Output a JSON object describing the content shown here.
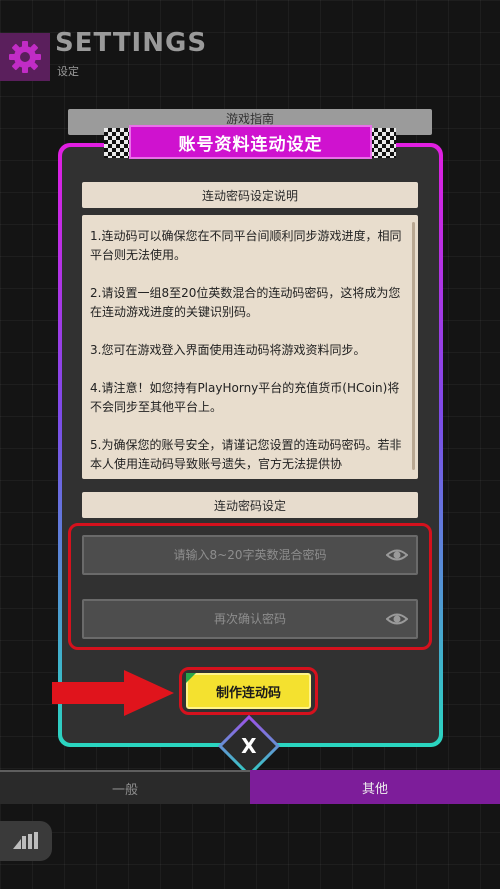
{
  "header": {
    "title": "SETTINGS",
    "subtitle": "设定",
    "icon": "gear-icon"
  },
  "background_tab": {
    "label": "游戏指南"
  },
  "modal": {
    "title": "账号资料连动设定",
    "description_header": "连动密码设定说明",
    "description": [
      "1.连动码可以确保您在不同平台间顺利同步游戏进度，相同平台则无法使用。",
      "2.请设置一组8至20位英数混合的连动码密码，这将成为您在连动游戏进度的关键识别码。",
      "3.您可在游戏登入界面使用连动码将游戏资料同步。",
      "4.请注意！如您持有PlayHorny平台的充值货币(HCoin)将不会同步至其他平台上。",
      "5.为确保您的账号安全，请谨记您设置的连动码密码。若非本人使用连动码导致账号遗失，官方无法提供协"
    ],
    "password_header": "连动密码设定",
    "password_placeholder": "请输入8~20字英数混合密码",
    "confirm_placeholder": "再次确认密码",
    "password_value": "",
    "confirm_value": "",
    "make_button": "制作连动码",
    "close_label": "X"
  },
  "tabs": [
    {
      "label": "一般",
      "active": false
    },
    {
      "label": "其他",
      "active": true
    }
  ],
  "colors": {
    "accent_magenta": "#cf12cf",
    "button_yellow": "#f4e12f",
    "highlight_red": "#d5111d",
    "teal": "#2ad6c0",
    "active_tab": "#7d1d9a"
  }
}
